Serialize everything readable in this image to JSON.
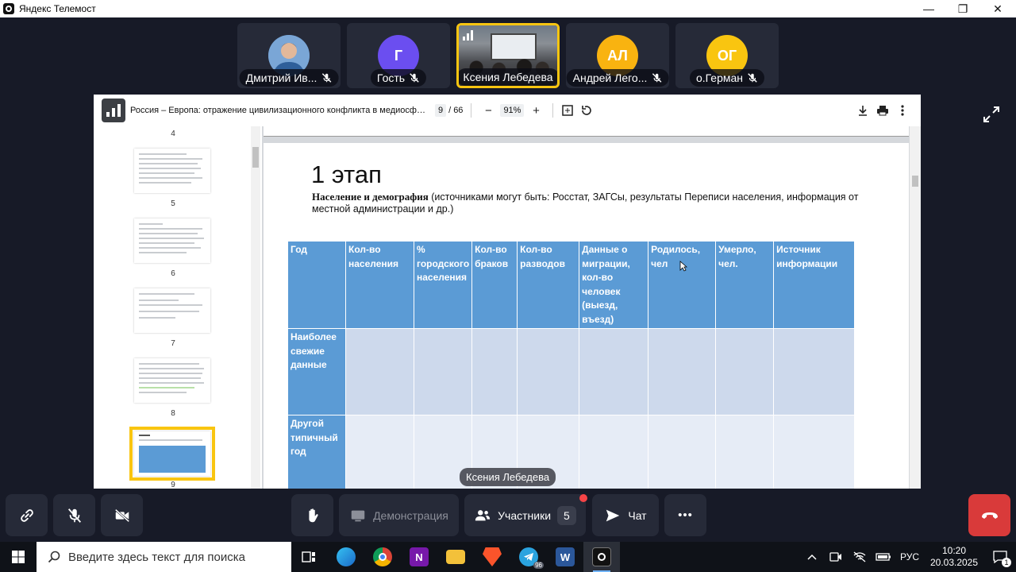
{
  "window": {
    "title": "Яндекс Телемост",
    "minimize": "—",
    "restore": "❐",
    "close": "✕"
  },
  "participants": [
    {
      "name": "Дмитрий Ив...",
      "avatar": "",
      "color": "#4a6fa5",
      "mic_muted": true
    },
    {
      "name": "Гость",
      "avatar": "Г",
      "color": "#6b4ef0",
      "mic_muted": true
    },
    {
      "name": "Ксения Лебедева",
      "avatar": "",
      "color": "",
      "mic_muted": false,
      "active": true
    },
    {
      "name": "Андрей Лего...",
      "avatar": "АЛ",
      "color": "#f9b310",
      "mic_muted": true
    },
    {
      "name": "о.Герман",
      "avatar": "ОГ",
      "color": "#f9c510",
      "mic_muted": true
    }
  ],
  "document": {
    "title": "Россия – Европа: отражение цивилизационного конфликта в медиосфере и р...",
    "current_page": "9",
    "page_sep": "/",
    "total_pages": "66",
    "zoom": "91%",
    "zoom_out": "−",
    "zoom_in": "+",
    "thumb_numbers": [
      "4",
      "5",
      "6",
      "7",
      "8",
      "9"
    ],
    "page": {
      "heading": "1 этап",
      "desc_bold": "Население и демография",
      "desc_rest": " (источниками могут быть: Росстат, ЗАГСы, результаты Переписи населения, информация от местной администрации и др.)",
      "table": {
        "headers": [
          "Год",
          "Кол-во населения",
          "% городского населения",
          "Кол-во браков",
          "Кол-во разводов",
          "Данные о миграции, кол-во человек (выезд, въезд)",
          "Родилось, чел",
          "Умерло, чел.",
          "Источник информации"
        ],
        "rows": [
          "Наиболее свежие данные",
          "Другой типичный год"
        ]
      }
    }
  },
  "speaker_label": "Ксения Лебедева",
  "controls": {
    "screen_share": "Демонстрация",
    "participants_label": "Участники",
    "participants_count": "5",
    "chat": "Чат",
    "more": "•••"
  },
  "taskbar": {
    "search_placeholder": "Введите здесь текст для поиска",
    "telegram_badge": "96",
    "language": "РУС",
    "time": "10:20",
    "date": "20.03.2025",
    "notifications": "1"
  },
  "colors": {
    "accent_yellow": "#f9c510",
    "table_header": "#5b9bd5",
    "end_call": "#d93a3a",
    "background": "#171a27"
  }
}
